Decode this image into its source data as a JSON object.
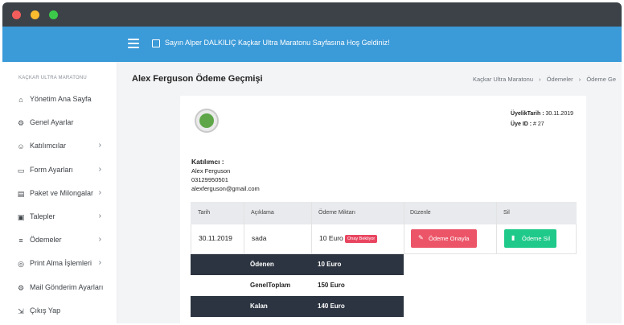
{
  "topbar": {
    "welcome": "Sayın Alper DALKILIÇ Kaçkar Ultra Maratonu Sayfasına Hoş Geldiniz!"
  },
  "sidebar": {
    "header": "KAÇKAR ULTRA MARATONU",
    "items": [
      {
        "label": "Yönetim Ana Sayfa",
        "icon": "home-icon",
        "glyph": "⌂",
        "has_chevron": false
      },
      {
        "label": "Genel Ayarlar",
        "icon": "gear-icon",
        "glyph": "⚙",
        "has_chevron": false
      },
      {
        "label": "Katılımcılar",
        "icon": "user-icon",
        "glyph": "☺",
        "has_chevron": true
      },
      {
        "label": "Form Ayarları",
        "icon": "form-icon",
        "glyph": "▭",
        "has_chevron": true
      },
      {
        "label": "Paket ve Milongalar",
        "icon": "package-icon",
        "glyph": "▤",
        "has_chevron": true
      },
      {
        "label": "Talepler",
        "icon": "requests-icon",
        "glyph": "▣",
        "has_chevron": true
      },
      {
        "label": "Ödemeler",
        "icon": "payments-icon",
        "glyph": "≡",
        "has_chevron": true
      },
      {
        "label": "Print Alma İşlemleri",
        "icon": "print-icon",
        "glyph": "◎",
        "has_chevron": true
      },
      {
        "label": "Mail Gönderim Ayarları",
        "icon": "mail-settings-icon",
        "glyph": "⚙",
        "has_chevron": false
      },
      {
        "label": "Çıkış Yap",
        "icon": "logout-icon",
        "glyph": "⇲",
        "has_chevron": false
      }
    ],
    "chevron": "›"
  },
  "page": {
    "title": "Alex Ferguson Ödeme Geçmişi",
    "breadcrumb": [
      "Kaçkar Ultra Maratonu",
      "Ödemeler",
      "Ödeme Ge"
    ],
    "breadcrumb_sep": "›"
  },
  "member": {
    "since_label": "ÜyelikTarih :",
    "since_value": "30.11.2019",
    "id_label": "Üye ID :",
    "id_value": "# 27"
  },
  "participant": {
    "heading": "Katılımcı :",
    "name": "Alex Ferguson",
    "phone": "03129950501",
    "email": "alexferguson@gmail.com"
  },
  "table": {
    "headers": [
      "Tarih",
      "Açıklama",
      "Ödeme Miktarı",
      "Düzenle",
      "Sil"
    ],
    "rows": [
      {
        "date": "30.11.2019",
        "description": "sada",
        "amount": "10 Euro",
        "status": "Onay Bekliyor",
        "edit_label": "Ödeme Onayla",
        "delete_label": "Ödeme Sil"
      }
    ]
  },
  "summary": [
    {
      "label": "Ödenen",
      "value": "10 Euro",
      "style": "dark"
    },
    {
      "label": "GenelToplam",
      "value": "150 Euro",
      "style": "light"
    },
    {
      "label": "Kalan",
      "value": "140  Euro",
      "style": "dark"
    }
  ],
  "colors": {
    "topbar": "#3b9ad8",
    "approve_button": "#ec5568",
    "delete_button": "#1fc98a",
    "status_badge": "#e94560",
    "summary_dark": "#2c3441"
  }
}
